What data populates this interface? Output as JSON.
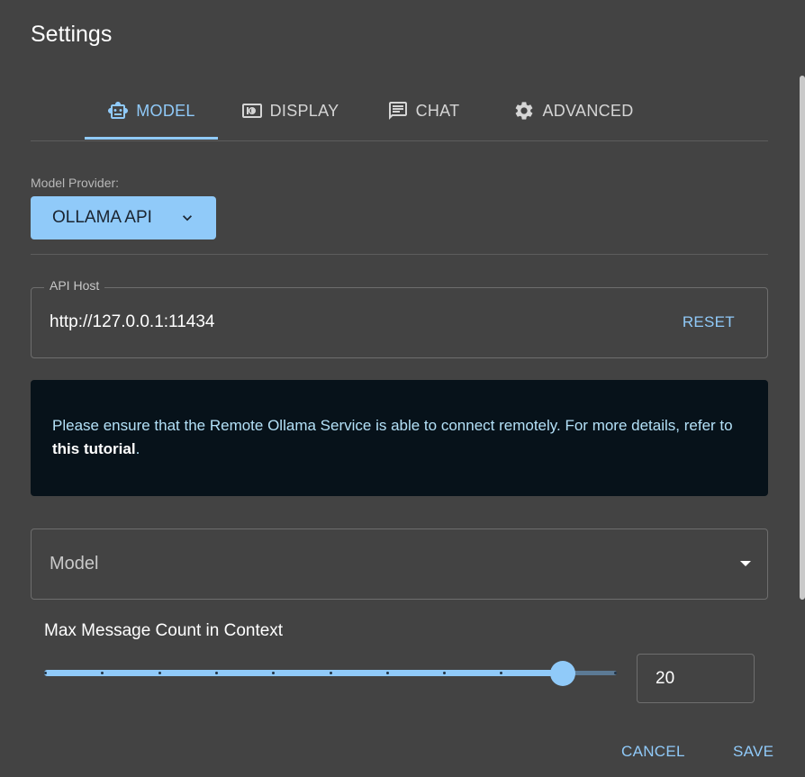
{
  "dialog": {
    "title": "Settings"
  },
  "tabs": [
    {
      "label": "MODEL",
      "icon": "robot-icon",
      "active": true
    },
    {
      "label": "DISPLAY",
      "icon": "display-icon",
      "active": false
    },
    {
      "label": "CHAT",
      "icon": "chat-icon",
      "active": false
    },
    {
      "label": "ADVANCED",
      "icon": "gear-icon",
      "active": false
    }
  ],
  "model_provider": {
    "label": "Model Provider:",
    "value": "OLLAMA API",
    "icon": "chevron-down-icon"
  },
  "api_host": {
    "label": "API Host",
    "value": "http://127.0.0.1:11434",
    "reset_label": "RESET"
  },
  "alert": {
    "text": "Please ensure that the Remote Ollama Service is able to connect remotely. For more details, refer to ",
    "link": "this tutorial",
    "suffix": "."
  },
  "model_select": {
    "label": "Model",
    "icon": "caret-down-icon"
  },
  "max_messages": {
    "label": "Max Message Count in Context",
    "value": "20",
    "slider_fraction": 0.905,
    "ticks": 11
  },
  "footer": {
    "cancel_label": "CANCEL",
    "save_label": "SAVE"
  },
  "colors": {
    "accent": "#90caf9",
    "background": "#434343",
    "alert_bg": "#07121a"
  }
}
